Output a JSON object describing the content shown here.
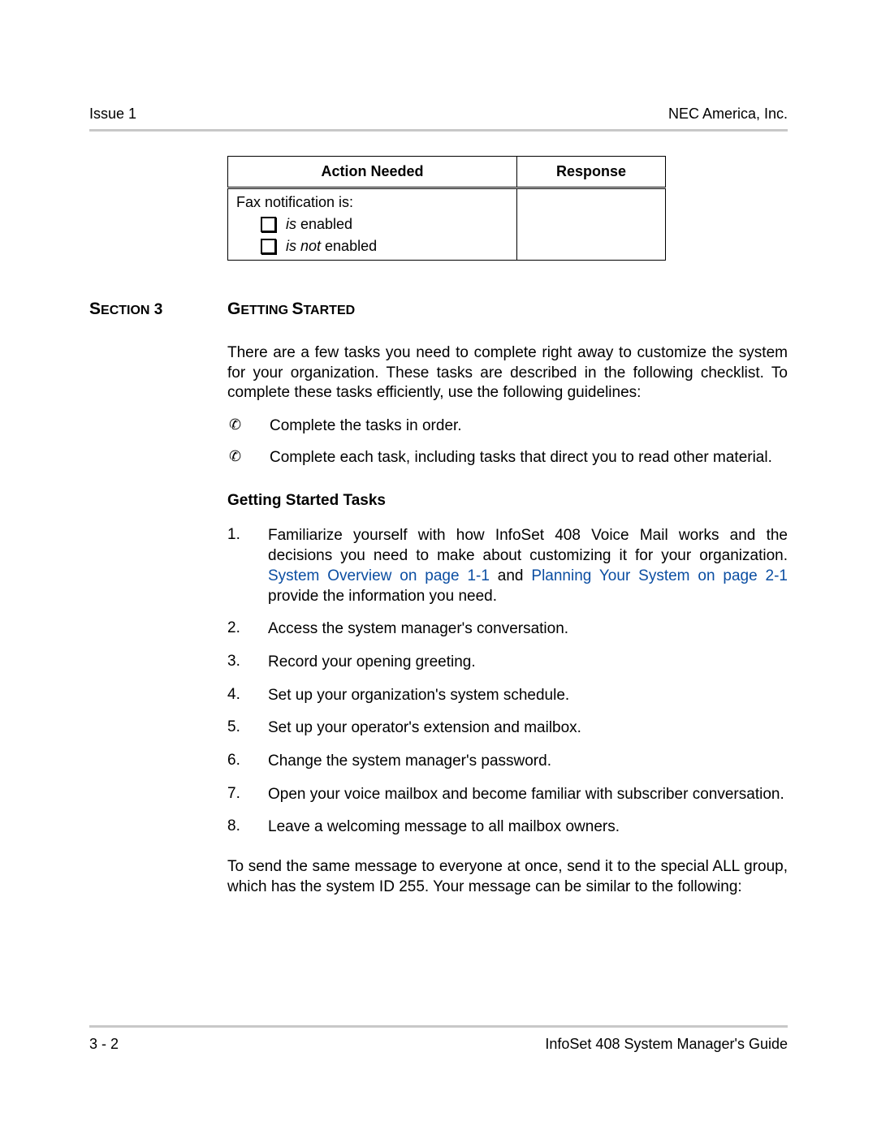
{
  "header": {
    "left": "Issue 1",
    "right": "NEC America, Inc."
  },
  "table": {
    "col1_header": "Action Needed",
    "col2_header": "Response",
    "row_label": "Fax notification is:",
    "opt1_italic": "is",
    "opt1_rest": " enabled",
    "opt2_italic": "is not",
    "opt2_rest": " enabled"
  },
  "section": {
    "label_prefix": "S",
    "label_rest": "ECTION",
    "number": " 3",
    "title_prefix": "G",
    "title_rest1": "ETTING ",
    "title_prefix2": "S",
    "title_rest2": "TARTED"
  },
  "intro": "There are a few tasks you need to complete right away to customize the system for your organization. These tasks are described in the following checklist. To complete these tasks efficiently, use the following guidelines:",
  "bullets": [
    "Complete the tasks in order.",
    "Complete each task, including tasks that direct you to read other material."
  ],
  "subhead": "Getting Started Tasks",
  "tasks": {
    "t1_pre": "Familiarize yourself with how InfoSet 408 Voice Mail works and the decisions you need to make about customizing it for your organization. ",
    "t1_link1": "System Overview on page 1-1",
    "t1_mid": " and ",
    "t1_link2": "Planning Your System on page 2-1",
    "t1_post": " provide the information you need.",
    "t2": "Access the system manager's conversation.",
    "t3": "Record your opening greeting.",
    "t4": "Set up your organization's system schedule.",
    "t5": "Set up your operator's extension and mailbox.",
    "t6": "Change the system manager's password.",
    "t7": "Open your voice mailbox and become familiar with subscriber conversation.",
    "t8": "Leave a welcoming message to all mailbox owners."
  },
  "closing": "To send the same message to everyone at once, send it to the special ALL group, which has the system ID 255. Your message can be similar to the following:",
  "footer": {
    "left": "3 - 2",
    "right": "InfoSet 408 System Manager's Guide"
  },
  "nums": [
    "1.",
    "2.",
    "3.",
    "4.",
    "5.",
    "6.",
    "7.",
    "8."
  ]
}
